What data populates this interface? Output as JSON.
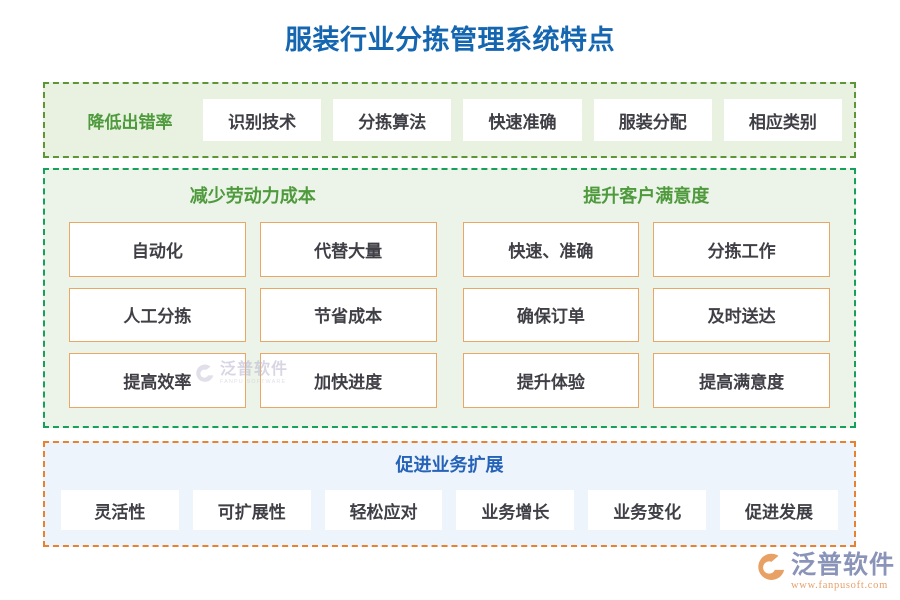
{
  "title": "服装行业分拣管理系统特点",
  "colors": {
    "title_blue": "#1566b0",
    "green_heading": "#4e9a3d",
    "blue_heading": "#2563b8",
    "green_dash": "#5d9537",
    "green_dash_alt": "#17a05a",
    "orange_dash": "#e8822e",
    "chip_border_orange": "#e8a765",
    "green_fill": "#e9f2e1",
    "green_fill_alt": "#ecf3e8",
    "blue_fill": "#eef4fc",
    "chip_text": "#3f3f46"
  },
  "sections": {
    "accuracy": {
      "label": "降低出错率",
      "items": [
        "识别技术",
        "分拣算法",
        "快速准确",
        "服装分配",
        "相应类别"
      ]
    },
    "labor": {
      "heading": "减少劳动力成本",
      "items": [
        "自动化",
        "代替大量",
        "人工分拣",
        "节省成本",
        "提高效率",
        "加快进度"
      ]
    },
    "satisfaction": {
      "heading": "提升客户满意度",
      "items": [
        "快速、准确",
        "分拣工作",
        "确保订单",
        "及时送达",
        "提升体验",
        "提高满意度"
      ]
    },
    "expansion": {
      "heading": "促进业务扩展",
      "items": [
        "灵活性",
        "可扩展性",
        "轻松应对",
        "业务增长",
        "业务变化",
        "促进发展"
      ]
    }
  },
  "watermark": {
    "cn": "泛普软件",
    "en": "FANPU SOFTWARE"
  },
  "brand": {
    "cn": "泛普软件",
    "en": "www.fanpusoft.com"
  }
}
